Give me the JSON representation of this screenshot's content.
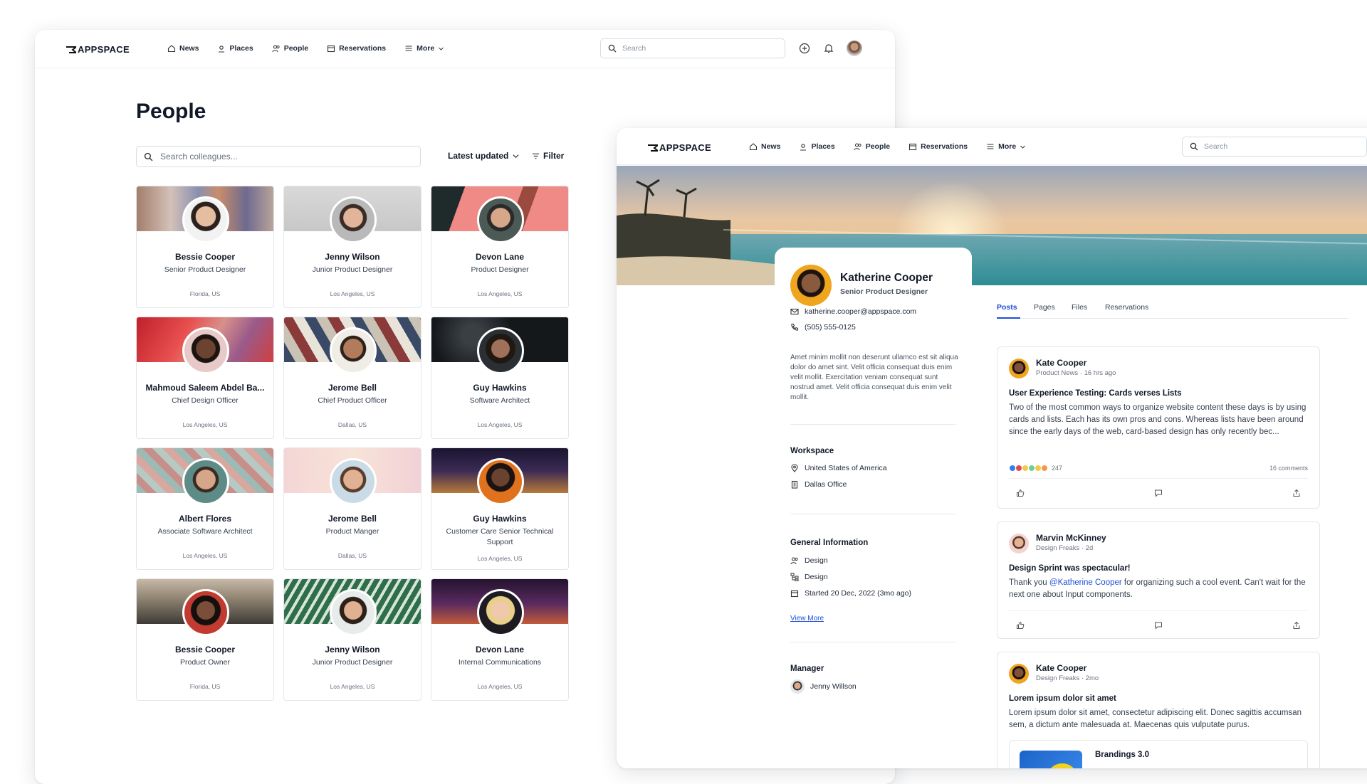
{
  "app": {
    "logo": "APPSPACE",
    "nav": [
      {
        "label": "News",
        "icon": "home-icon"
      },
      {
        "label": "Places",
        "icon": "location-pin-icon"
      },
      {
        "label": "People",
        "icon": "people-icon"
      },
      {
        "label": "Reservations",
        "icon": "calendar-icon"
      },
      {
        "label": "More",
        "icon": "hamburger-icon"
      }
    ],
    "search_placeholder": "Search"
  },
  "people_page": {
    "title": "People",
    "search_placeholder": "Search colleagues...",
    "sort_label": "Latest updated",
    "filter_label": "Filter",
    "cards": [
      {
        "name": "Bessie Cooper",
        "role": "Senior Product Designer",
        "location": "Florida, US"
      },
      {
        "name": "Jenny Wilson",
        "role": "Junior Product Designer",
        "location": "Los Angeles, US"
      },
      {
        "name": "Devon Lane",
        "role": "Product Designer",
        "location": "Los Angeles, US"
      },
      {
        "name": "Mahmoud Saleem Abdel Ba...",
        "role": "Chief Design Officer",
        "location": "Los Angeles, US"
      },
      {
        "name": "Jerome Bell",
        "role": "Chief Product Officer",
        "location": "Dallas, US"
      },
      {
        "name": "Guy Hawkins",
        "role": "Software Architect",
        "location": "Los Angeles, US"
      },
      {
        "name": "Albert Flores",
        "role": "Associate Software Architect",
        "location": "Los Angeles, US"
      },
      {
        "name": "Jerome Bell",
        "role": "Product Manger",
        "location": "Dallas, US"
      },
      {
        "name": "Guy Hawkins",
        "role": "Customer Care Senior Technical Support",
        "location": "Los Angeles, US"
      },
      {
        "name": "Bessie Cooper",
        "role": "Product Owner",
        "location": "Florida, US"
      },
      {
        "name": "Jenny Wilson",
        "role": "Junior Product Designer",
        "location": "Los Angeles, US"
      },
      {
        "name": "Devon Lane",
        "role": "Internal Communications",
        "location": "Los Angeles, US"
      }
    ]
  },
  "profile": {
    "name": "Katherine Cooper",
    "title": "Senior Product Designer",
    "email": "katherine.cooper@appspace.com",
    "phone": "(505) 555-0125",
    "bio": "Amet minim mollit non deserunt ullamco est sit aliqua dolor do amet sint. Velit officia consequat duis enim velit mollit. Exercitation veniam consequat sunt nostrud amet. Velit officia consequat duis enim velit mollit.",
    "workspace_heading": "Workspace",
    "workspace": [
      "United States of America",
      "Dallas Office"
    ],
    "general_heading": "General Information",
    "general": [
      "Design",
      "Design",
      "Started 20 Dec, 2022 (3mo ago)"
    ],
    "view_more": "View More",
    "manager_heading": "Manager",
    "manager": "Jenny Willson"
  },
  "tabs": [
    "Posts",
    "Pages",
    "Files",
    "Reservations"
  ],
  "posts": [
    {
      "author": "Kate Cooper",
      "meta": "Product News · 16 hrs ago",
      "title": "User Experience Testing: Cards verses Lists",
      "body": "Two of the most common ways to organize website content these days is by using cards and lists. Each has its own pros and cons. Whereas lists have been around since the early days of the web, card-based design has only recently bec...",
      "reactions": "247",
      "comments": "16 comments"
    },
    {
      "author": "Marvin McKinney",
      "meta": "Design Freaks · 2d",
      "title": "Design Sprint was spectacular!",
      "body_pre": "Thank you ",
      "mention": "@Katherine Cooper",
      "body_post": " for organizing such a cool event. Can't wait for the next one about Input components."
    },
    {
      "author": "Kate Cooper",
      "meta": "Design Freaks · 2mo",
      "title": "Lorem ipsum dolor sit amet",
      "body": "Lorem ipsum dolor sit amet, consectetur adipiscing elit. Donec sagittis accumsan sem, a dictum ante malesuada at. Maecenas quis vulputate purus.",
      "embed_title": "Brandings 3.0"
    }
  ],
  "colors": {
    "accent": "#1d4ed8",
    "text": "#111827"
  }
}
